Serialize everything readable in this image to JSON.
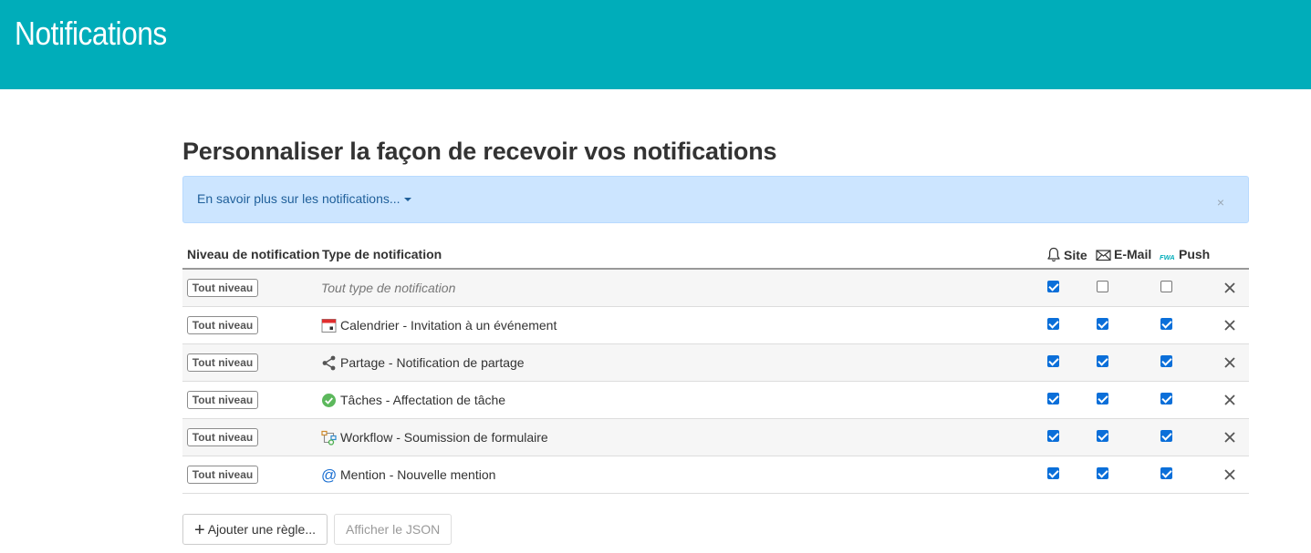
{
  "header": {
    "title": "Notifications"
  },
  "page": {
    "heading": "Personnaliser la façon de recevoir vos notifications"
  },
  "info": {
    "link_text": "En savoir plus sur les notifications...",
    "close_text": "×"
  },
  "table": {
    "columns": {
      "level": "Niveau de notification",
      "type": "Type de notification",
      "site": "Site",
      "email": "E-Mail",
      "push": "Push",
      "push_icon_text": "FWA"
    },
    "rows": [
      {
        "level": "Tout niveau",
        "type": "Tout type de notification",
        "icon": "none",
        "site": true,
        "email": false,
        "push": false
      },
      {
        "level": "Tout niveau",
        "type": "Calendrier - Invitation à un événement",
        "icon": "calendar-icon",
        "site": true,
        "email": true,
        "push": true
      },
      {
        "level": "Tout niveau",
        "type": "Partage - Notification de partage",
        "icon": "share-icon",
        "site": true,
        "email": true,
        "push": true
      },
      {
        "level": "Tout niveau",
        "type": "Tâches - Affectation de tâche",
        "icon": "task-check-icon",
        "site": true,
        "email": true,
        "push": true
      },
      {
        "level": "Tout niveau",
        "type": "Workflow - Soumission de formulaire",
        "icon": "workflow-icon",
        "site": true,
        "email": true,
        "push": true
      },
      {
        "level": "Tout niveau",
        "type": "Mention - Nouvelle mention",
        "icon": "at-icon",
        "site": true,
        "email": true,
        "push": true
      }
    ]
  },
  "buttons": {
    "add_rule": "Ajouter une règle...",
    "show_json": "Afficher le JSON"
  },
  "colors": {
    "header_bg": "#00adba",
    "info_bg": "#cce5ff",
    "checkbox_on": "#0b6fd9"
  }
}
